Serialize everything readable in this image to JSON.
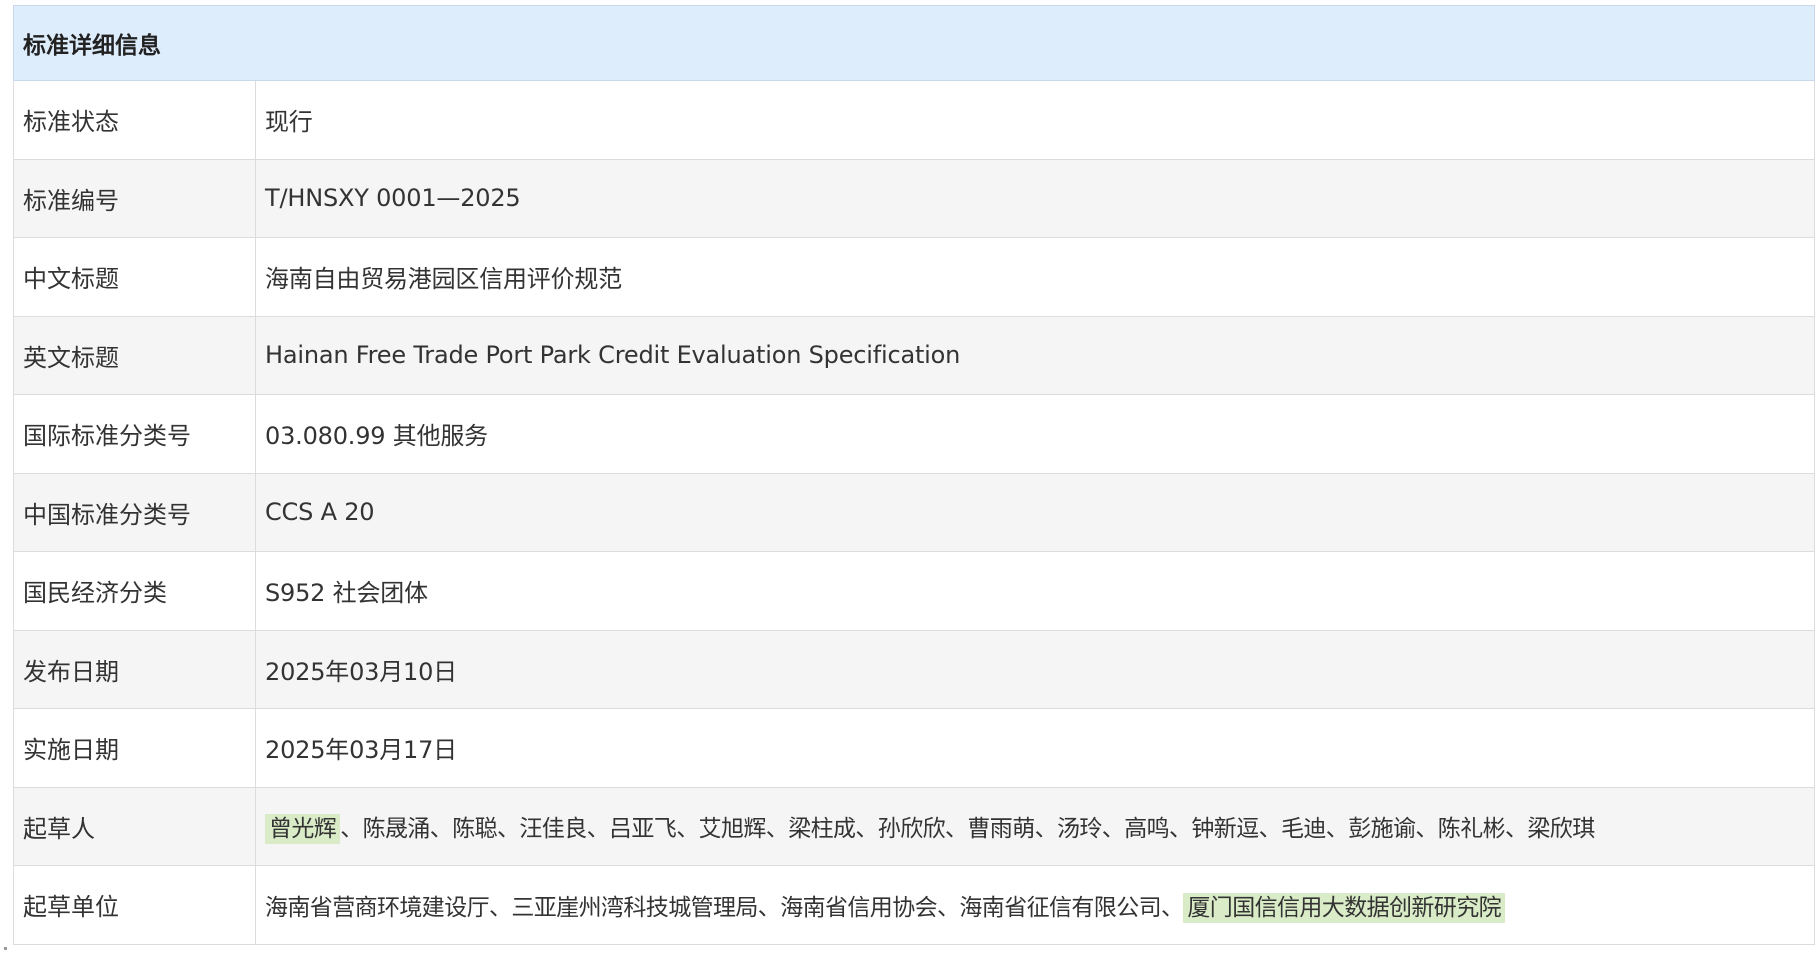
{
  "table": {
    "header": "标准详细信息",
    "rows": [
      {
        "label": "标准状态",
        "value": "现行"
      },
      {
        "label": "标准编号",
        "value": "T/HNSXY 0001—2025"
      },
      {
        "label": "中文标题",
        "value": "海南自由贸易港园区信用评价规范"
      },
      {
        "label": "英文标题",
        "value": "Hainan Free Trade Port Park Credit Evaluation Specification"
      },
      {
        "label": "国际标准分类号",
        "value": "03.080.99 其他服务"
      },
      {
        "label": "中国标准分类号",
        "value": "CCS A 20"
      },
      {
        "label": "国民经济分类",
        "value": "S952 社会团体"
      },
      {
        "label": "发布日期",
        "value": "2025年03月10日"
      },
      {
        "label": "实施日期",
        "value": "2025年03月17日"
      }
    ],
    "drafters": {
      "label": "起草人",
      "highlighted": "曾光辉",
      "rest": "、陈晟涌、陈聪、汪佳良、吕亚飞、艾旭辉、梁柱成、孙欣欣、曹雨萌、汤玲、高鸣、钟新逗、毛迪、彭施谕、陈礼彬、梁欣琪"
    },
    "drafting_units": {
      "label": "起草单位",
      "plain": "海南省营商环境建设厅、三亚崖州湾科技城管理局、海南省信用协会、海南省征信有限公司、",
      "highlighted": "厦门国信信用大数据创新研究院"
    }
  },
  "colors": {
    "header_bg": "#deedfc",
    "alt_row_bg": "#f5f5f5",
    "highlight_bg": "#d9ecc7",
    "border": "#dcdcdc"
  }
}
